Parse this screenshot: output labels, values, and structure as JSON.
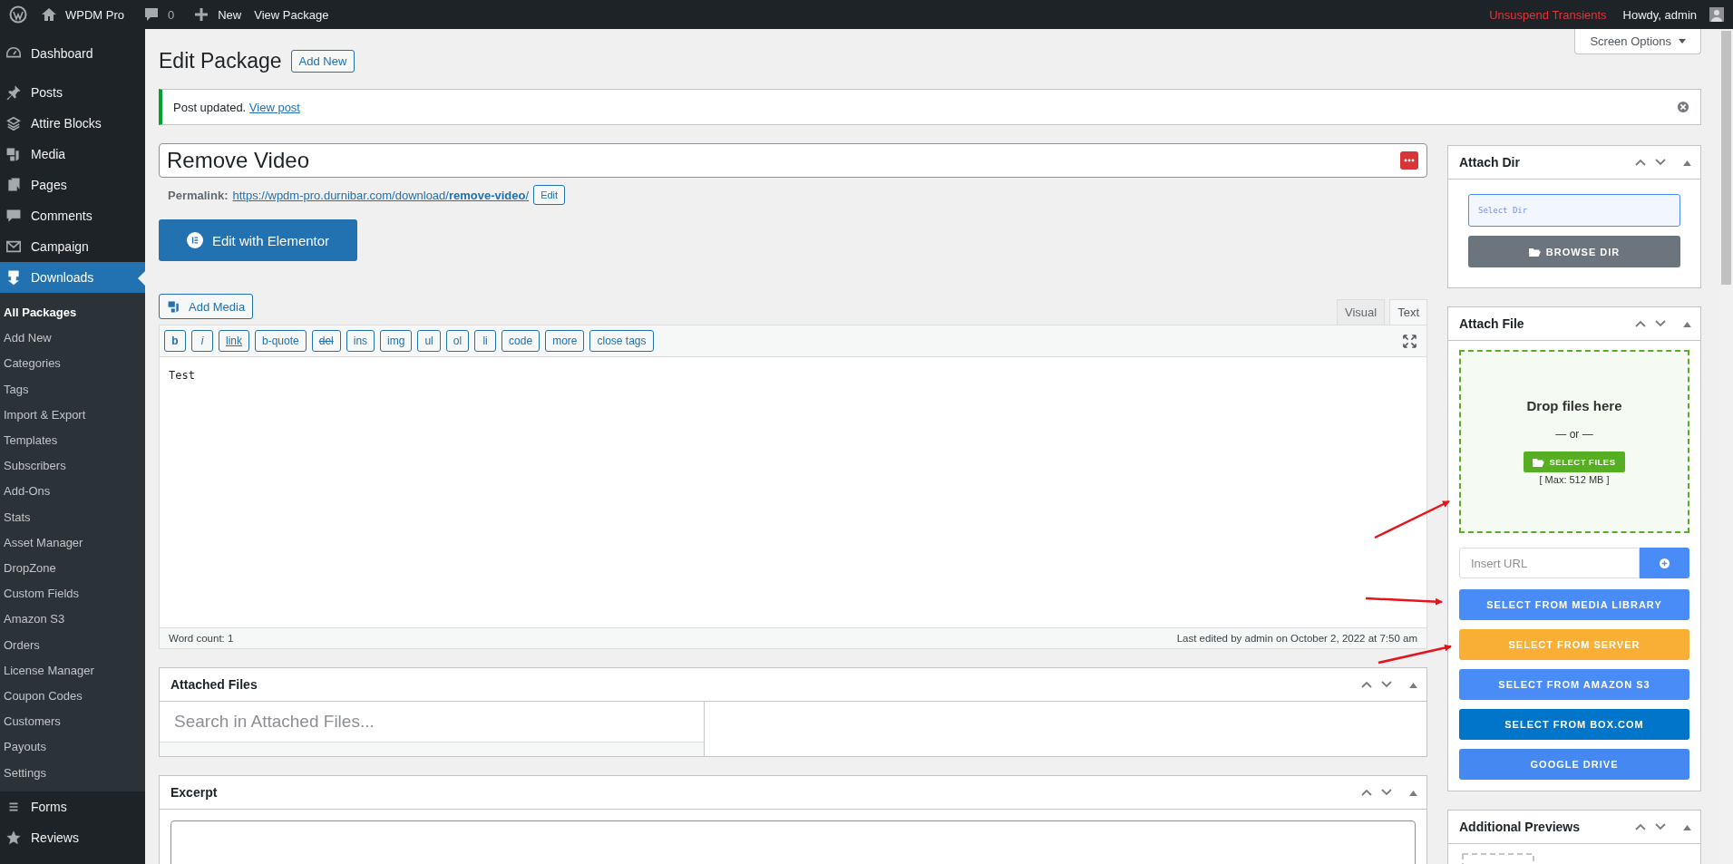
{
  "admin_bar": {
    "site": "WPDM Pro",
    "comments": "0",
    "new": "New",
    "view": "View Package",
    "notice": "Unsuspend Transients",
    "howdy": "Howdy, admin"
  },
  "sidebar": {
    "items": [
      {
        "label": "Dashboard",
        "selected": false
      },
      {
        "label": "Posts",
        "selected": false
      },
      {
        "label": "Attire Blocks",
        "selected": false
      },
      {
        "label": "Media",
        "selected": false
      },
      {
        "label": "Pages",
        "selected": false
      },
      {
        "label": "Comments",
        "selected": false
      },
      {
        "label": "Campaign",
        "selected": false
      },
      {
        "label": "Downloads",
        "selected": true,
        "children": [
          {
            "label": "All Packages",
            "selected": true
          },
          {
            "label": "Add New",
            "selected": false
          },
          {
            "label": "Categories",
            "selected": false
          },
          {
            "label": "Tags",
            "selected": false
          },
          {
            "label": "Import & Export",
            "selected": false
          },
          {
            "label": "Templates",
            "selected": false
          },
          {
            "label": "Subscribers",
            "selected": false
          },
          {
            "label": "Add-Ons",
            "selected": false
          },
          {
            "label": "Stats",
            "selected": false
          },
          {
            "label": "Asset Manager",
            "selected": false
          },
          {
            "label": "DropZone",
            "selected": false
          },
          {
            "label": "Custom Fields",
            "selected": false
          },
          {
            "label": "Amazon S3",
            "selected": false
          },
          {
            "label": "Orders",
            "selected": false
          },
          {
            "label": "License Manager",
            "selected": false
          },
          {
            "label": "Coupon Codes",
            "selected": false
          },
          {
            "label": "Customers",
            "selected": false
          },
          {
            "label": "Payouts",
            "selected": false
          },
          {
            "label": "Settings",
            "selected": false
          }
        ]
      },
      {
        "label": "Forms",
        "selected": false
      },
      {
        "label": "Reviews",
        "selected": false
      }
    ]
  },
  "page": {
    "title": "Edit Package",
    "add_new": "Add New",
    "screen_options": "Screen Options"
  },
  "notice": {
    "text": "Post updated.",
    "link": "View post"
  },
  "post_title": {
    "value": "Remove Video"
  },
  "permalink": {
    "label": "Permalink:",
    "url_base": "https://wpdm-pro.durnibar.com/download/",
    "slug": "remove-video",
    "trail": "/",
    "edit": "Edit"
  },
  "elementor_button": "Edit with Elementor",
  "editor": {
    "add_media": "Add Media",
    "tabs": [
      {
        "label": "Visual",
        "selected": false
      },
      {
        "label": "Text",
        "selected": true
      }
    ],
    "toolbar": [
      {
        "label": "b",
        "kind": "bold"
      },
      {
        "label": "i",
        "kind": "italic"
      },
      {
        "label": "link",
        "kind": "link"
      },
      {
        "label": "b-quote",
        "kind": "plain"
      },
      {
        "label": "del",
        "kind": "strike"
      },
      {
        "label": "ins",
        "kind": "plain"
      },
      {
        "label": "img",
        "kind": "plain"
      },
      {
        "label": "ul",
        "kind": "plain"
      },
      {
        "label": "ol",
        "kind": "plain"
      },
      {
        "label": "li",
        "kind": "plain"
      },
      {
        "label": "code",
        "kind": "plain"
      },
      {
        "label": "more",
        "kind": "plain"
      },
      {
        "label": "close tags",
        "kind": "plain"
      }
    ],
    "content": "Test",
    "word_count": "Word count: 1",
    "last_edited": "Last edited by admin on October 2, 2022 at 7:50 am"
  },
  "attached_files": {
    "title": "Attached Files",
    "search_placeholder": "Search in Attached Files..."
  },
  "excerpt": {
    "title": "Excerpt"
  },
  "attach_dir": {
    "title": "Attach Dir",
    "placeholder": "Select Dir",
    "button": "BROWSE DIR"
  },
  "attach_file": {
    "title": "Attach File",
    "drop": "Drop files here",
    "or": "— or —",
    "select": "SELECT FILES",
    "max": "[ Max: 512 MB ]",
    "url_placeholder": "Insert URL",
    "buttons": [
      {
        "label": "SELECT FROM MEDIA LIBRARY",
        "color": "#4a8cf7"
      },
      {
        "label": "SELECT FROM SERVER",
        "color": "#f9ae35"
      },
      {
        "label": "SELECT FROM AMAZON S3",
        "color": "#4a8cf7"
      },
      {
        "label": "SELECT FROM BOX.COM",
        "color": "#0075c9"
      },
      {
        "label": "GOOGLE DRIVE",
        "color": "#4688f1"
      }
    ]
  },
  "additional_previews": {
    "title": "Additional Previews"
  }
}
